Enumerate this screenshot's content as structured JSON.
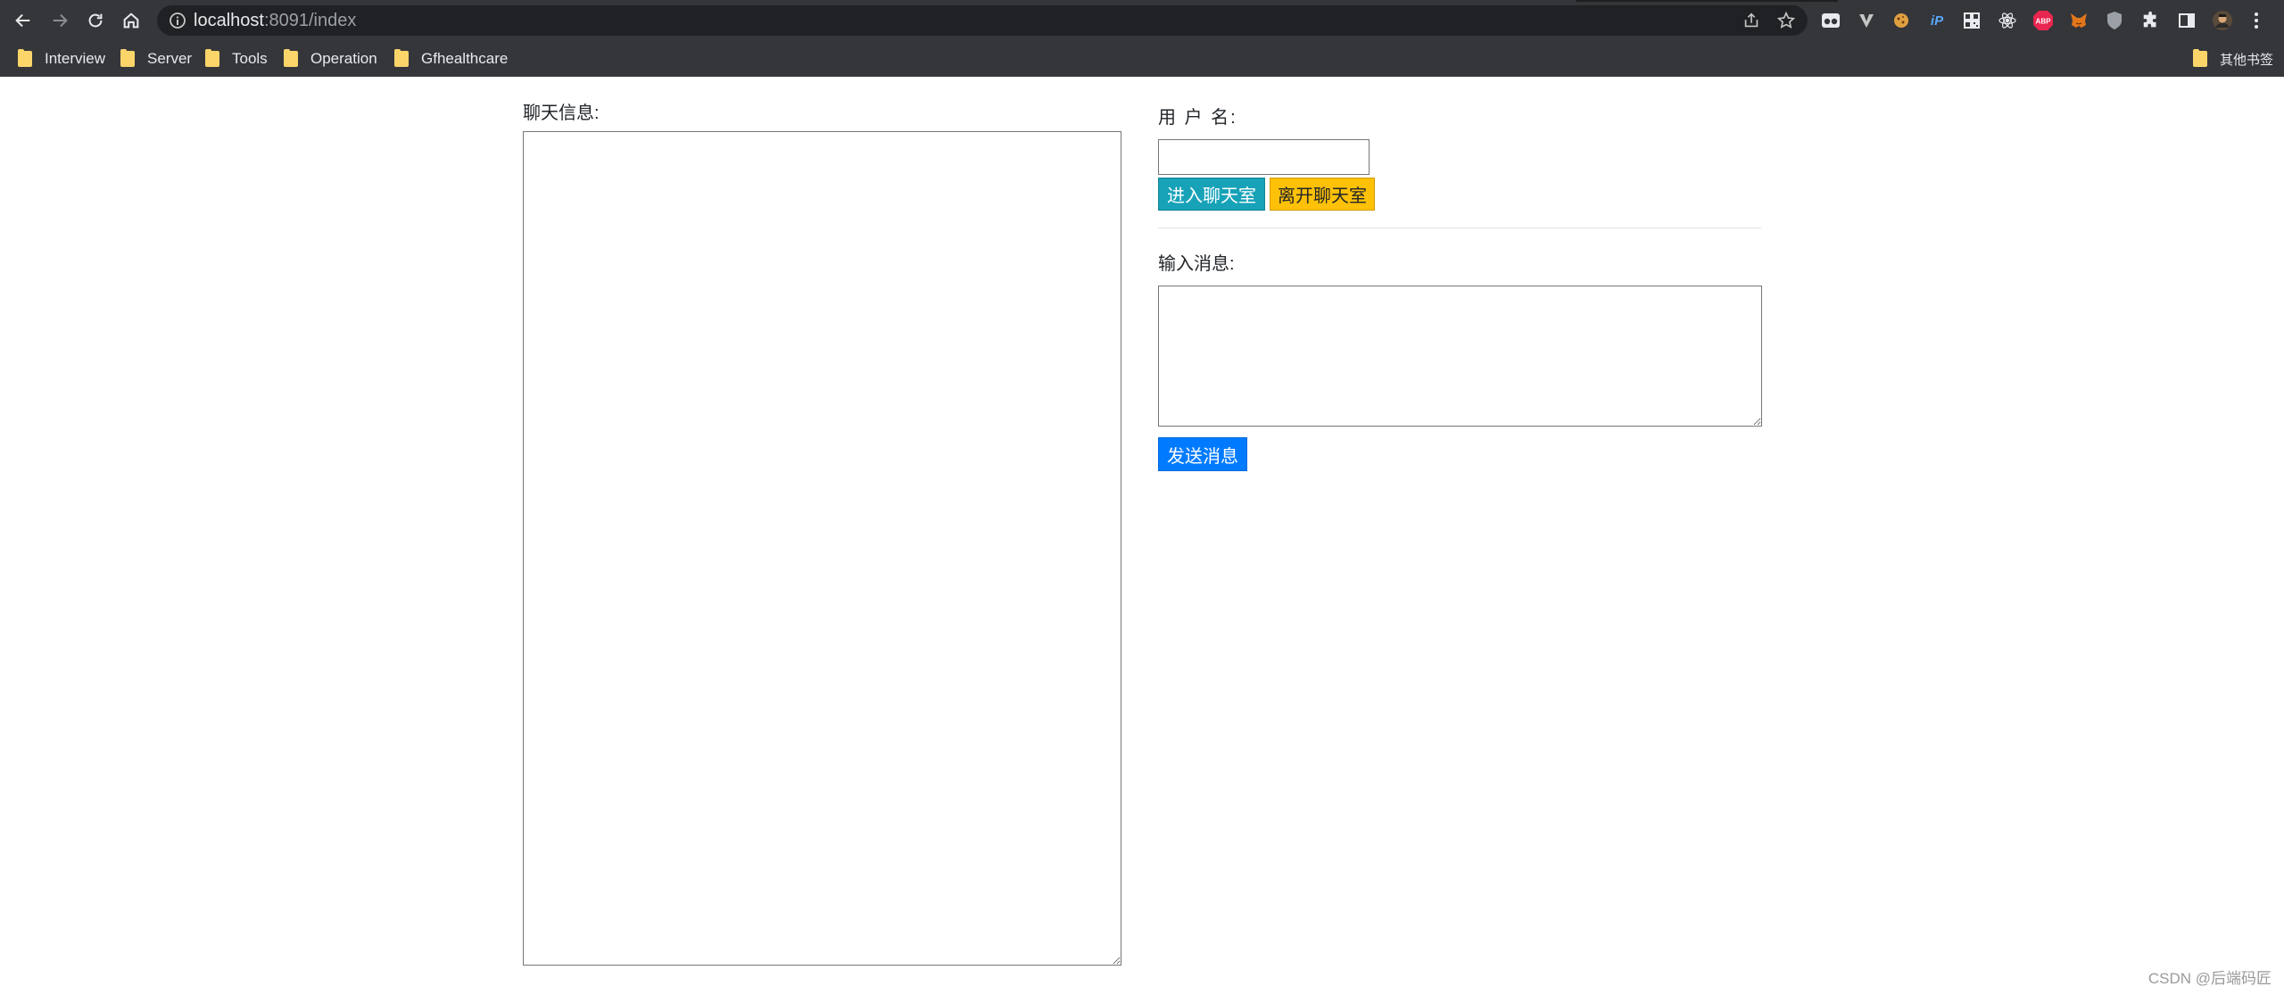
{
  "browser": {
    "url_host": "localhost",
    "url_rest": ":8091/index",
    "bookmarks": [
      {
        "label": "Interview"
      },
      {
        "label": "Server"
      },
      {
        "label": "Tools"
      },
      {
        "label": "Operation"
      },
      {
        "label": "Gfhealthcare"
      }
    ],
    "other_bookmarks": "其他书签",
    "extensions": [
      "glasses-extension-icon",
      "v-extension-icon",
      "cookie-extension-icon",
      "ip-extension-icon",
      "qr-extension-icon",
      "react-extension-icon",
      "adblock-extension-icon",
      "metamask-extension-icon",
      "shield-extension-icon",
      "puzzle-icon",
      "side-panel-icon",
      "avatar",
      "kebab-menu-icon"
    ],
    "abp_label": "ABP",
    "ip_label": "iP"
  },
  "page": {
    "chat_label": "聊天信息:",
    "chat_log": "",
    "username_label": "用 户 名:",
    "username_value": "",
    "enter_button": "进入聊天室",
    "leave_button": "离开聊天室",
    "message_label": "输入消息:",
    "message_value": "",
    "send_button": "发送消息"
  },
  "watermark": "CSDN @后端码匠",
  "colors": {
    "chrome_bg": "#35363a",
    "omnibox_bg": "#202124",
    "enter_button": "#17a2b8",
    "leave_button": "#ffc107",
    "send_button": "#007bff"
  }
}
